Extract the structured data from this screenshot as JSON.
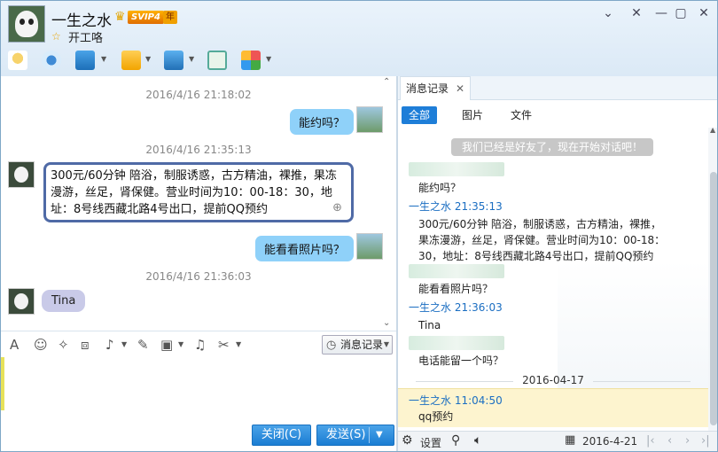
{
  "window": {
    "contact_name": "一生之水",
    "vip_badge": "SVIP4",
    "year_badge": "年",
    "signature": "开工咯",
    "controls": [
      "chevron-down-icon",
      "minimize-icon",
      "maximize-icon",
      "close-icon"
    ]
  },
  "toolbar": {
    "icons": [
      "microphone-icon",
      "video-camera-icon",
      "remote-desktop-icon",
      "send-file-icon",
      "screen-share-icon",
      "invite-icon",
      "apps-icon"
    ]
  },
  "chat": {
    "messages": [
      {
        "timestamp": "2016/4/16 21:18:02",
        "text": "能约吗？",
        "from": "me"
      },
      {
        "timestamp": "2016/4/16 21:35:13",
        "text": "300元/60分钟  陪浴，制服诱惑，古方精油，裸推，果冻漫游，丝足，肾保健。营业时间为10：00-18：30，地址：8号线西藏北路4号出口，提前QQ预约",
        "from": "other"
      },
      {
        "timestamp": "",
        "text": "能看看照片吗？",
        "from": "me"
      },
      {
        "timestamp": "2016/4/16 21:36:03",
        "text": "Tina",
        "from": "other"
      }
    ]
  },
  "input_toolbar": {
    "icons": [
      "font-icon",
      "emoji-icon",
      "magic-icon",
      "screenshot-icon",
      "voice-icon",
      "edit-icon",
      "image-icon",
      "music-icon",
      "scissors-icon"
    ],
    "history_label": "消息记录"
  },
  "buttons": {
    "close_label": "关闭(C)",
    "send_label": "发送(S)"
  },
  "history": {
    "tab_label": "消息记录",
    "filters": [
      "全部",
      "图片",
      "文件"
    ],
    "friend_notice": "我们已经是好友了，现在开始对话吧！",
    "entries": [
      {
        "text": "能约吗？"
      },
      {
        "sender": "一生之水 21:35:13",
        "text": "300元/60分钟  陪浴，制服诱惑，古方精油，裸推，果冻漫游，丝足，肾保健。营业时间为10：00-18：30，地址：8号线西藏北路4号出口，提前QQ预约"
      },
      {
        "text": "能看看照片吗？"
      },
      {
        "sender": "一生之水 21:36:03",
        "text": "Tina"
      },
      {
        "text": "电话能留一个吗？"
      }
    ],
    "date_divider": "2016-04-17",
    "highlight": {
      "sender": "一生之水 11:04:50",
      "text": "qq预约"
    },
    "footer": {
      "settings_label": "设置",
      "date": "2016-4-21"
    }
  },
  "colors": {
    "accent": "#1e7ed8",
    "my_bubble": "#8fd1f9",
    "tina_bubble": "#c9cae8",
    "sender_name": "#1b6ec2"
  }
}
